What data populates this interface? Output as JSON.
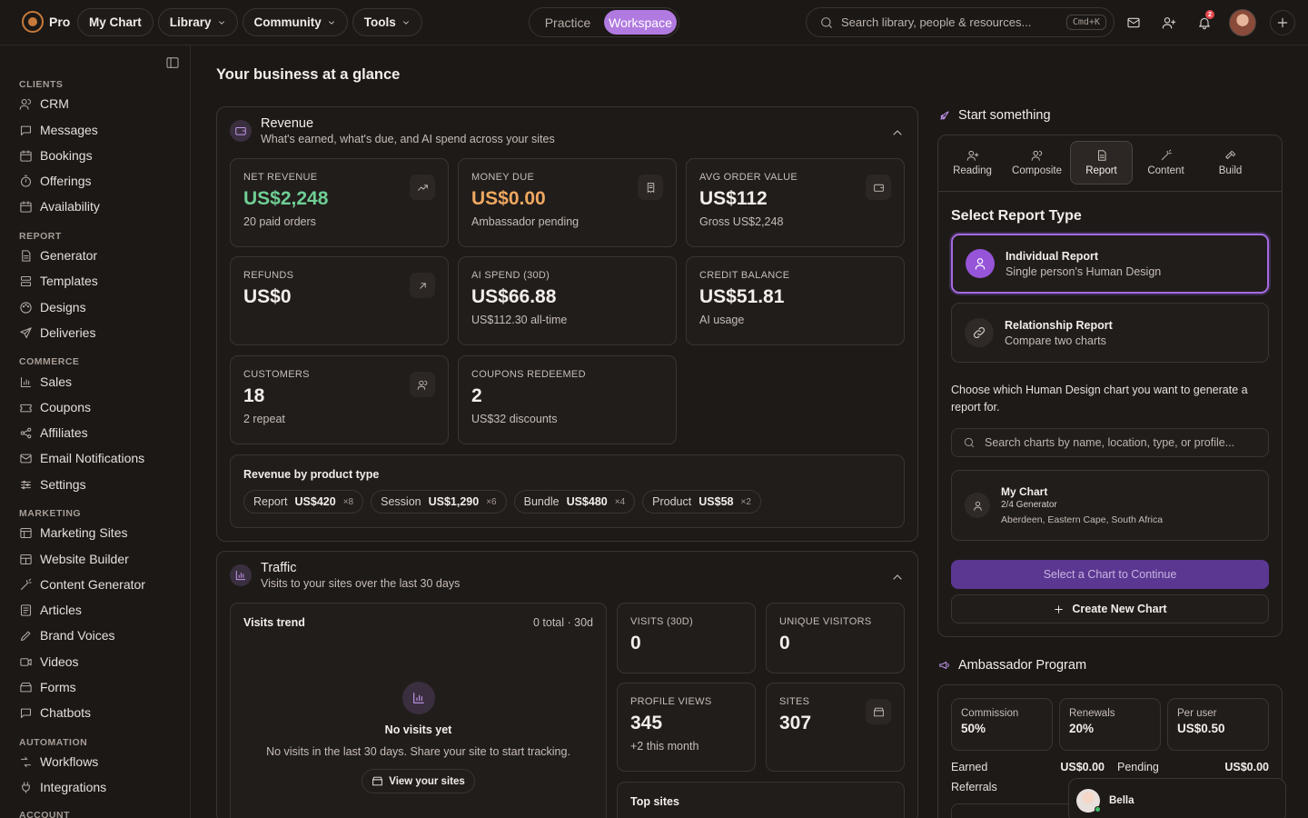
{
  "topbar": {
    "brand": "Pro",
    "nav": [
      {
        "label": "My Chart",
        "dropdown": false
      },
      {
        "label": "Library",
        "dropdown": true
      },
      {
        "label": "Community",
        "dropdown": true
      },
      {
        "label": "Tools",
        "dropdown": true
      }
    ],
    "modes": [
      "Practice",
      "Workspace"
    ],
    "active_mode": "Workspace",
    "search_placeholder": "Search library, people & resources...",
    "search_shortcut": "Cmd+K",
    "notification_count": "2",
    "icons": [
      "mail-icon",
      "add-user-icon",
      "bell-icon",
      "plus-icon"
    ]
  },
  "sidebar": {
    "sections": [
      {
        "title": "CLIENTS",
        "items": [
          "CRM",
          "Messages",
          "Bookings",
          "Offerings",
          "Availability"
        ]
      },
      {
        "title": "REPORT",
        "items": [
          "Generator",
          "Templates",
          "Designs",
          "Deliveries"
        ]
      },
      {
        "title": "COMMERCE",
        "items": [
          "Sales",
          "Coupons",
          "Affiliates",
          "Email Notifications",
          "Settings"
        ]
      },
      {
        "title": "MARKETING",
        "items": [
          "Marketing Sites",
          "Website Builder",
          "Content Generator",
          "Articles",
          "Brand Voices",
          "Videos",
          "Forms",
          "Chatbots"
        ]
      },
      {
        "title": "AUTOMATION",
        "items": [
          "Workflows",
          "Integrations"
        ]
      },
      {
        "title": "ACCOUNT",
        "items": []
      }
    ]
  },
  "main": {
    "title": "Your business at a glance",
    "revenue": {
      "title": "Revenue",
      "subtitle": "What's earned, what's due, and AI spend across your sites",
      "cards": [
        {
          "label": "NET REVENUE",
          "value": "US$2,248",
          "sub": "20 paid orders",
          "tone": "green",
          "icon": "trend-up-icon"
        },
        {
          "label": "MONEY DUE",
          "value": "US$0.00",
          "sub": "Ambassador pending",
          "tone": "orange",
          "icon": "receipt-icon"
        },
        {
          "label": "AVG ORDER VALUE",
          "value": "US$112",
          "sub": "Gross US$2,248",
          "tone": "",
          "icon": "wallet-icon"
        },
        {
          "label": "REFUNDS",
          "value": "US$0",
          "sub": "",
          "tone": "",
          "icon": "arrow-up-right-icon"
        },
        {
          "label": "AI SPEND (30D)",
          "value": "US$66.88",
          "sub": "US$112.30 all-time",
          "tone": "",
          "icon": ""
        },
        {
          "label": "CREDIT BALANCE",
          "value": "US$51.81",
          "sub": "AI usage",
          "tone": "",
          "icon": ""
        },
        {
          "label": "CUSTOMERS",
          "value": "18",
          "sub": "2 repeat",
          "tone": "",
          "icon": "users-icon"
        },
        {
          "label": "COUPONS REDEEMED",
          "value": "2",
          "sub": "US$32 discounts",
          "tone": "",
          "icon": ""
        }
      ],
      "by_product_title": "Revenue by product type",
      "by_product": [
        {
          "name": "Report",
          "amount": "US$420",
          "count": "×8"
        },
        {
          "name": "Session",
          "amount": "US$1,290",
          "count": "×6"
        },
        {
          "name": "Bundle",
          "amount": "US$480",
          "count": "×4"
        },
        {
          "name": "Product",
          "amount": "US$58",
          "count": "×2"
        }
      ]
    },
    "traffic": {
      "title": "Traffic",
      "subtitle": "Visits to your sites over the last 30 days",
      "trend_title": "Visits trend",
      "trend_meta": "0 total · 30d",
      "empty_title": "No visits yet",
      "empty_sub": "No visits in the last 30 days. Share your site to start tracking.",
      "view_sites": "View your sites",
      "stats": [
        {
          "label": "VISITS (30D)",
          "value": "0",
          "sub": ""
        },
        {
          "label": "UNIQUE VISITORS",
          "value": "0",
          "sub": ""
        },
        {
          "label": "PROFILE VIEWS",
          "value": "345",
          "sub": "+2 this month"
        },
        {
          "label": "SITES",
          "value": "307",
          "sub": ""
        }
      ],
      "top_sites": "Top sites"
    }
  },
  "start": {
    "title": "Start something",
    "tabs": [
      {
        "label": "Reading",
        "icon": "user-plus-icon"
      },
      {
        "label": "Composite",
        "icon": "users-icon"
      },
      {
        "label": "Report",
        "icon": "document-icon"
      },
      {
        "label": "Content",
        "icon": "wand-icon"
      },
      {
        "label": "Build",
        "icon": "hammer-icon"
      }
    ],
    "active_tab": "Report",
    "select_title": "Select Report Type",
    "options": [
      {
        "title": "Individual Report",
        "sub": "Single person's Human Design"
      },
      {
        "title": "Relationship Report",
        "sub": "Compare two charts"
      }
    ],
    "choose_text": "Choose which Human Design chart you want to generate a report for.",
    "search_placeholder": "Search charts by name, location, type, or profile...",
    "chart": {
      "name": "My Chart",
      "type": "2/4 Generator",
      "location": "Aberdeen, Eastern Cape, South Africa"
    },
    "continue_label": "Select a Chart to Continue",
    "create_label": "Create New Chart"
  },
  "ambassador": {
    "title": "Ambassador Program",
    "tiles": [
      {
        "label": "Commission",
        "value": "50%"
      },
      {
        "label": "Renewals",
        "value": "20%"
      },
      {
        "label": "Per user",
        "value": "US$0.50"
      }
    ],
    "earned_label": "Earned",
    "earned_value": "US$0.00",
    "pending_label": "Pending",
    "pending_value": "US$0.00",
    "referrals_label": "Referrals"
  },
  "chat": {
    "name": "Bella"
  },
  "colors": {
    "accent": "#b07ae0",
    "positive": "#6fce94",
    "warning": "#eea860",
    "primary_button": "#5b3791"
  }
}
